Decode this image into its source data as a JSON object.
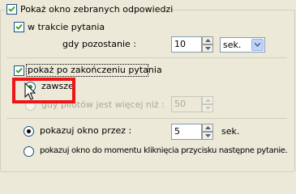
{
  "main_option": {
    "label": "Pokaż okno zebranych odpowiedzi",
    "checked": true
  },
  "during_question": {
    "label": "w trakcie pytania",
    "checked": true,
    "remaining_label": "gdy pozostanie :",
    "remaining_value": "10",
    "unit_value": "sek.",
    "unit_options": [
      "sek."
    ]
  },
  "after_question": {
    "label": "pokaż po zakończeniu pytania",
    "checked": true,
    "always_label": "zawsze",
    "always_selected": true,
    "pilots_label": "gdy pilotów jest więcej niż :",
    "pilots_value": "50",
    "pilots_enabled": false
  },
  "display": {
    "show_for_label": "pokazuj okno przez :",
    "show_for_selected": true,
    "show_for_value": "5",
    "show_for_unit": "sek.",
    "until_next_label": "pokazuj okno do momentu kliknięcia przycisku następne pytanie.",
    "until_next_selected": false
  },
  "colors": {
    "background": "#ece9d8",
    "highlight": "#ee1515",
    "checkmark": "#21a121",
    "disabled_text": "#aca899"
  }
}
